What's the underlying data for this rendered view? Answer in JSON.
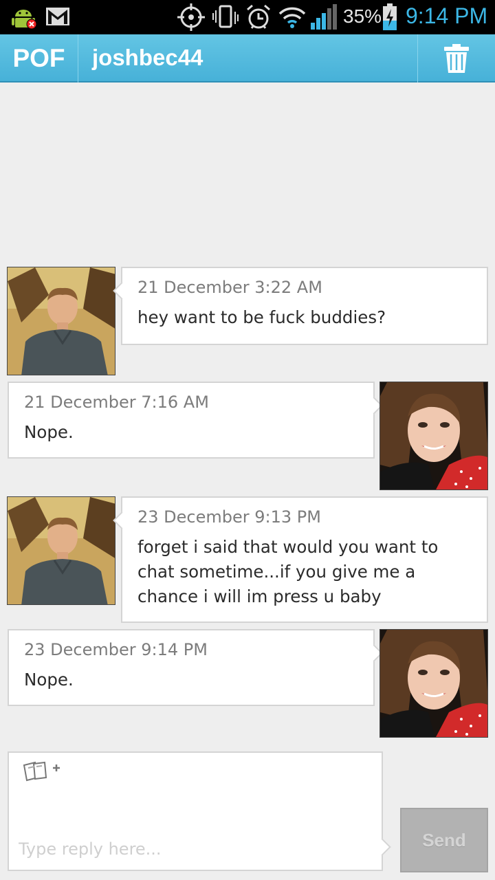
{
  "status_bar": {
    "battery_percent": "35%",
    "time": "9:14 PM",
    "icons": [
      "android-debug-icon",
      "gmail-icon",
      "gps-icon",
      "vibrate-icon",
      "alarm-icon",
      "wifi-icon",
      "signal-icon",
      "battery-charging-icon"
    ]
  },
  "action_bar": {
    "app_logo": "POF",
    "title": "joshbec44",
    "delete_icon": "trash-icon"
  },
  "messages": [
    {
      "side": "left",
      "sender": "joshbec44",
      "time": "21 December 3:22 AM",
      "text": "hey want to be fuck buddies?"
    },
    {
      "side": "right",
      "sender": "me",
      "time": "21 December 7:16 AM",
      "text": "Nope."
    },
    {
      "side": "left",
      "sender": "joshbec44",
      "time": "23 December 9:13 PM",
      "text": "forget i said that would you want to chat sometime...if you give me a chance i will im press u baby"
    },
    {
      "side": "right",
      "sender": "me",
      "time": "23 December 9:14 PM",
      "text": "Nope."
    }
  ],
  "reply": {
    "placeholder": "Type reply here...",
    "value": "",
    "attach_icon": "attach-photo-icon",
    "send_label": "Send"
  },
  "colors": {
    "action_bar": "#51b8de",
    "clock": "#3cb7e6",
    "background": "#eeeeee",
    "send_button": "#b2b2b2"
  }
}
